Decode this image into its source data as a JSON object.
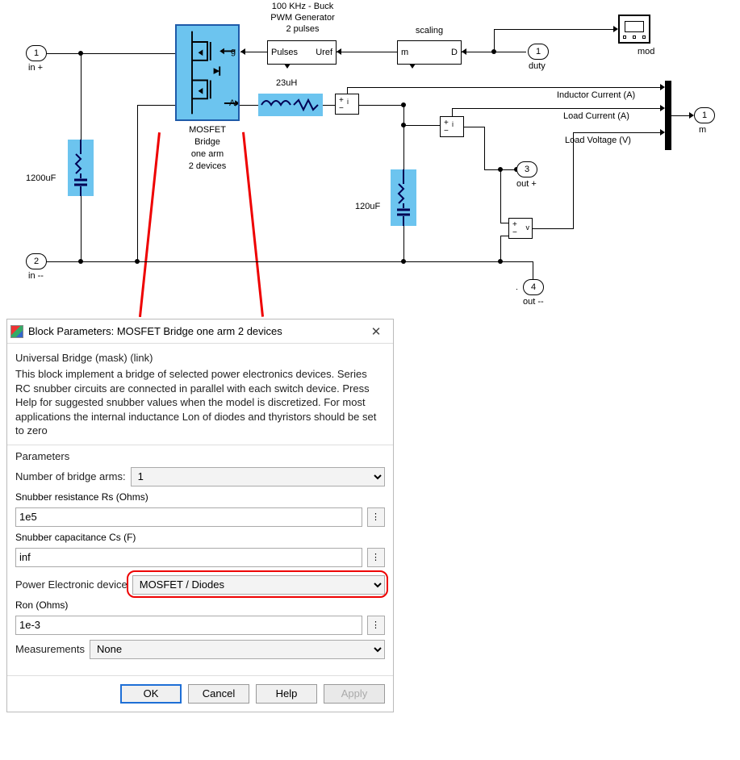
{
  "diagram": {
    "ports": {
      "in_plus": {
        "num": "1",
        "label": "in +"
      },
      "in_minus": {
        "num": "2",
        "label": "in --"
      },
      "duty": {
        "num": "1",
        "label": "duty"
      },
      "out_plus": {
        "num": "3",
        "label": "out +"
      },
      "out_minus": {
        "num": "4",
        "label": "out --"
      },
      "m": {
        "num": "1",
        "label": "m"
      }
    },
    "blocks": {
      "pwm": {
        "title_l1": "100 KHz - Buck",
        "title_l2": "PWM Generator",
        "title_l3": "2 pulses",
        "out": "Pulses",
        "in": "Uref"
      },
      "scaling": {
        "title": "scaling",
        "out": "m",
        "in": "D"
      },
      "scope": {
        "label": "mod"
      },
      "mosfet": {
        "label_l1": "MOSFET",
        "label_l2": "Bridge",
        "label_l3": "one arm",
        "label_l4": "2 devices",
        "port_g": "g",
        "port_A": "A"
      },
      "ind": {
        "label": "23uH"
      },
      "cap_in": {
        "label": "1200uF"
      },
      "cap_out": {
        "label": "120uF"
      },
      "signals": {
        "il": "Inductor Current (A)",
        "iload": "Load Current (A)",
        "vload": "Load Voltage (V)"
      }
    }
  },
  "dialog": {
    "title": "Block Parameters: MOSFET Bridge one arm 2 devices",
    "mask": "Universal Bridge (mask) (link)",
    "description": "This block implement a bridge of selected power electronics devices. Series RC snubber circuits are connected in parallel with each switch device.  Press Help for suggested snubber values when the model is discretized. For most applications the internal inductance Lon of diodes and thyristors should be set to zero",
    "params_heading": "Parameters",
    "fields": {
      "arms": {
        "label": "Number of bridge arms:",
        "value": "1"
      },
      "rs": {
        "label": "Snubber resistance Rs (Ohms)",
        "value": "1e5"
      },
      "cs": {
        "label": "Snubber capacitance Cs (F)",
        "value": "inf"
      },
      "device": {
        "label": "Power Electronic device",
        "value": "MOSFET / Diodes"
      },
      "ron": {
        "label": "Ron (Ohms)",
        "value": "1e-3"
      },
      "meas": {
        "label": "Measurements",
        "value": "None"
      }
    },
    "buttons": {
      "ok": "OK",
      "cancel": "Cancel",
      "help": "Help",
      "apply": "Apply"
    }
  }
}
